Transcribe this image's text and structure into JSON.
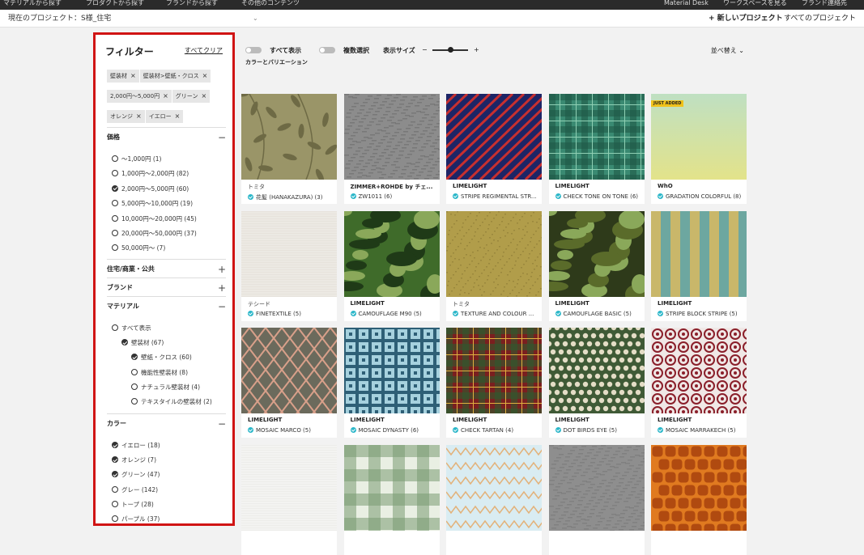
{
  "topnav": {
    "items": [
      "マテリアルから探す",
      "プロダクトから探す",
      "ブランドから探す",
      "その他のコンテンツ"
    ],
    "right_items": [
      "Material Desk",
      "ワークスペースを見る",
      "ブランド連絡先"
    ]
  },
  "project_bar": {
    "current_label": "現在のプロジェクト：",
    "current_value": "S様_住宅",
    "new_project": "+ 新しいプロジェクト",
    "all_projects": "すべてのプロジェクト"
  },
  "filter": {
    "title": "フィルター",
    "clear_all": "すべてクリア",
    "chips": [
      "壁装材",
      "壁装材>壁紙・クロス",
      "2,000円〜5,000円",
      "グリーン",
      "オレンジ",
      "イエロー"
    ],
    "sections": {
      "price": {
        "label": "価格",
        "options": [
          {
            "label": "〜1,000円 (1)",
            "checked": false
          },
          {
            "label": "1,000円〜2,000円 (82)",
            "checked": false
          },
          {
            "label": "2,000円〜5,000円 (60)",
            "checked": true
          },
          {
            "label": "5,000円〜10,000円 (19)",
            "checked": false
          },
          {
            "label": "10,000円〜20,000円 (45)",
            "checked": false
          },
          {
            "label": "20,000円〜50,000円 (37)",
            "checked": false
          },
          {
            "label": "50,000円〜 (7)",
            "checked": false
          }
        ]
      },
      "usage": {
        "label": "住宅/商業・公共"
      },
      "brand": {
        "label": "ブランド"
      },
      "material": {
        "label": "マテリアル",
        "options": [
          {
            "label": "すべて表示",
            "checked": false,
            "level": 0
          },
          {
            "label": "壁装材 (67)",
            "checked": true,
            "level": 1
          },
          {
            "label": "壁紙・クロス (60)",
            "checked": true,
            "level": 2
          },
          {
            "label": "機能性壁装材 (8)",
            "checked": false,
            "level": 2
          },
          {
            "label": "ナチュラル壁装材 (4)",
            "checked": false,
            "level": 2
          },
          {
            "label": "テキスタイルの壁装材 (2)",
            "checked": false,
            "level": 2
          }
        ]
      },
      "color": {
        "label": "カラー",
        "options": [
          {
            "label": "イエロー (18)",
            "checked": true
          },
          {
            "label": "オレンジ (7)",
            "checked": true
          },
          {
            "label": "グリーン (47)",
            "checked": true
          },
          {
            "label": "グレー (142)",
            "checked": false
          },
          {
            "label": "トープ (28)",
            "checked": false
          },
          {
            "label": "パープル (37)",
            "checked": false
          }
        ]
      }
    }
  },
  "toolbar": {
    "show_all": "すべて表示",
    "show_all_sub": "カラーとバリエーション",
    "multi_select": "複数選択",
    "display_size": "表示サイズ",
    "minus": "−",
    "plus": "+",
    "sort": "並べ替え"
  },
  "products": [
    {
      "brand": "トミタ",
      "name": "花髪 (HANAKAZURA) (3)",
      "pattern": "leaf",
      "colors": [
        "#9a9568",
        "#6e6a45"
      ]
    },
    {
      "brand": "ZIMMER+ROHDE by チェ...",
      "name": "ZW1011 (6)",
      "pattern": "noise",
      "colors": [
        "#8c8c8c",
        "#6a6a6a"
      ]
    },
    {
      "brand": "LIMELIGHT",
      "name": "STRIPE REGIMENTAL STR...",
      "pattern": "diag",
      "colors": [
        "#1d2566",
        "#c73030"
      ]
    },
    {
      "brand": "LIMELIGHT",
      "name": "CHECK TONE ON TONE (6)",
      "pattern": "plaid",
      "colors": [
        "#3a8a72",
        "#1f5a48"
      ]
    },
    {
      "brand": "WhO",
      "name": "GRADATION COLORFUL (8)",
      "pattern": "gradient",
      "colors": [
        "#bfe0c2",
        "#e3e38a"
      ],
      "badge": "JUST ADDED"
    },
    {
      "brand": "テシード",
      "name": "FINETEXTILE (5)",
      "pattern": "plain",
      "colors": [
        "#ece9e3",
        "#e2ded6"
      ]
    },
    {
      "brand": "LIMELIGHT",
      "name": "CAMOUFLAGE M90 (5)",
      "pattern": "camo",
      "colors": [
        "#3f6b2a",
        "#1f3a17"
      ]
    },
    {
      "brand": "トミタ",
      "name": "TEXTURE AND COLOUR ...",
      "pattern": "speckle",
      "colors": [
        "#b19d4a",
        "#8a7a36"
      ]
    },
    {
      "brand": "LIMELIGHT",
      "name": "CAMOUFLAGE BASIC (5)",
      "pattern": "camo",
      "colors": [
        "#2e3a1a",
        "#5a6b2a"
      ]
    },
    {
      "brand": "LIMELIGHT",
      "name": "STRIPE BLOCK STRIPE (5)",
      "pattern": "vstripe",
      "colors": [
        "#6da7a0",
        "#c9b76a"
      ]
    },
    {
      "brand": "LIMELIGHT",
      "name": "MOSAIC MARCO (5)",
      "pattern": "diamond",
      "colors": [
        "#6b6a5c",
        "#d9a08a"
      ]
    },
    {
      "brand": "LIMELIGHT",
      "name": "MOSAIC DYNASTY (6)",
      "pattern": "tile",
      "colors": [
        "#2e5f76",
        "#a6d1de"
      ]
    },
    {
      "brand": "LIMELIGHT",
      "name": "CHECK TARTAN (4)",
      "pattern": "tartan",
      "colors": [
        "#7a1f1f",
        "#2f5a2f"
      ]
    },
    {
      "brand": "LIMELIGHT",
      "name": "DOT BIRDS EYE (5)",
      "pattern": "dots",
      "colors": [
        "#e4ddc6",
        "#3f5a36"
      ]
    },
    {
      "brand": "LIMELIGHT",
      "name": "MOSAIC MARRAKECH (5)",
      "pattern": "ornate",
      "colors": [
        "#f0e8e6",
        "#8a1f2a"
      ]
    },
    {
      "brand": "",
      "name": "",
      "pattern": "plain",
      "colors": [
        "#f3f3f1",
        "#e8e8e4"
      ]
    },
    {
      "brand": "",
      "name": "",
      "pattern": "gingham",
      "colors": [
        "#e9efe3",
        "#7a9a72"
      ]
    },
    {
      "brand": "",
      "name": "",
      "pattern": "zigzag",
      "colors": [
        "#d9ecf2",
        "#e3b27a"
      ]
    },
    {
      "brand": "",
      "name": "",
      "pattern": "noise",
      "colors": [
        "#8e8e8e",
        "#777"
      ]
    },
    {
      "brand": "",
      "name": "",
      "pattern": "giraffe",
      "colors": [
        "#e07a20",
        "#b04a10"
      ]
    }
  ]
}
